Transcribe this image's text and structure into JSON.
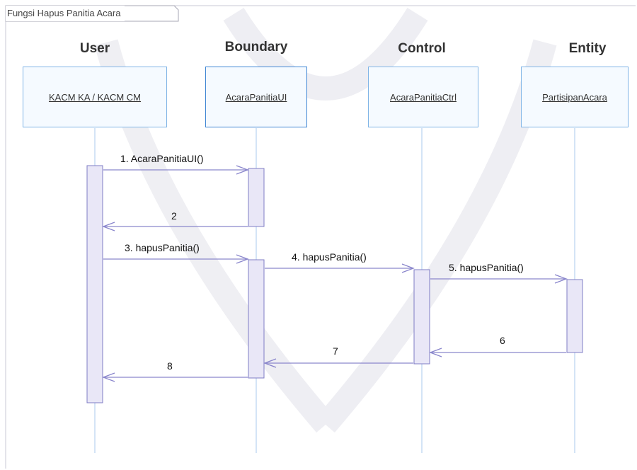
{
  "frame_title": "Fungsi Hapus Panitia Acara",
  "categories": {
    "user": "User",
    "boundary": "Boundary",
    "control": "Control",
    "entity": "Entity"
  },
  "lifelines": {
    "user": "KACM KA / KACM CM",
    "boundary": "AcaraPanitiaUI",
    "control": "AcaraPanitiaCtrl",
    "entity": "PartisipanAcara"
  },
  "messages": [
    {
      "label": "1. AcaraPanitiaUI()",
      "from": "user",
      "to": "boundary",
      "kind": "call"
    },
    {
      "label": "2",
      "from": "boundary",
      "to": "user",
      "kind": "return"
    },
    {
      "label": "3. hapusPanitia()",
      "from": "user",
      "to": "boundary",
      "kind": "call"
    },
    {
      "label": "4. hapusPanitia()",
      "from": "boundary",
      "to": "control",
      "kind": "call"
    },
    {
      "label": "5. hapusPanitia()",
      "from": "control",
      "to": "entity",
      "kind": "call"
    },
    {
      "label": "6",
      "from": "entity",
      "to": "control",
      "kind": "return"
    },
    {
      "label": "7",
      "from": "control",
      "to": "boundary",
      "kind": "return"
    },
    {
      "label": "8",
      "from": "boundary",
      "to": "user",
      "kind": "return"
    }
  ],
  "colors": {
    "frame": "#c9c9d4",
    "lifeline_border": "#7fb4e6",
    "message_line": "#8a86cc",
    "activation_fill": "#e9e7f7",
    "activation_border": "#7f7cc4"
  }
}
